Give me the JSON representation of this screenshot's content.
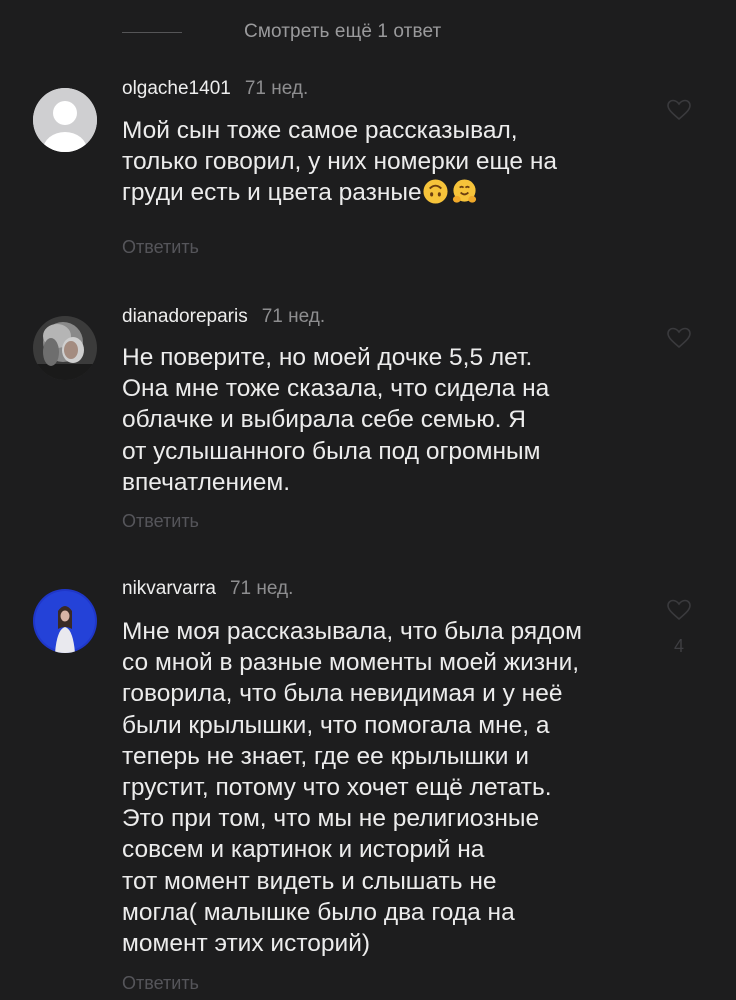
{
  "thread": {
    "view_more_label": "Смотреть ещё 1 ответ"
  },
  "comments": [
    {
      "username": "olgache1401",
      "time": "71 нед.",
      "text_lines": [
        "Мой сын тоже самое рассказывал,",
        "только говорил, у них номерки еще на",
        "груди есть и цвета разные"
      ],
      "emojis": [
        "upside-down-face-icon",
        "hugging-face-icon"
      ],
      "reply_label": "Ответить",
      "avatar": "default-avatar-icon"
    },
    {
      "username": "dianadoreparis",
      "time": "71 нед.",
      "text_lines": [
        "Не поверите, но моей дочке 5,5 лет.",
        "Она мне тоже сказала, что сидела на",
        "облачке и выбирала себе семью. Я",
        "от услышанного была под огромным",
        "впечатлением."
      ],
      "reply_label": "Ответить",
      "avatar": "user-photo"
    },
    {
      "username": "nikvarvarra",
      "time": "71 нед.",
      "text_lines": [
        "Мне моя рассказывала, что была рядом",
        "со мной в разные моменты моей жизни,",
        "говорила, что была невидимая и у неё",
        "были крылышки, что помогала мне, а",
        "теперь не знает, где ее крылышки и",
        "грустит, потому что хочет ещё летать.",
        "Это при том, что мы не религиозные",
        "совсем и картинок и историй на",
        "тот момент видеть и слышать не",
        "могла( малышке было два года на",
        "момент этих историй)"
      ],
      "likes": "4",
      "reply_label": "Ответить",
      "avatar": "user-photo"
    }
  ],
  "colors": {
    "background": "#1d1d1e",
    "text": "#ececec",
    "muted": "#8e8e90",
    "reply": "#55555a"
  }
}
